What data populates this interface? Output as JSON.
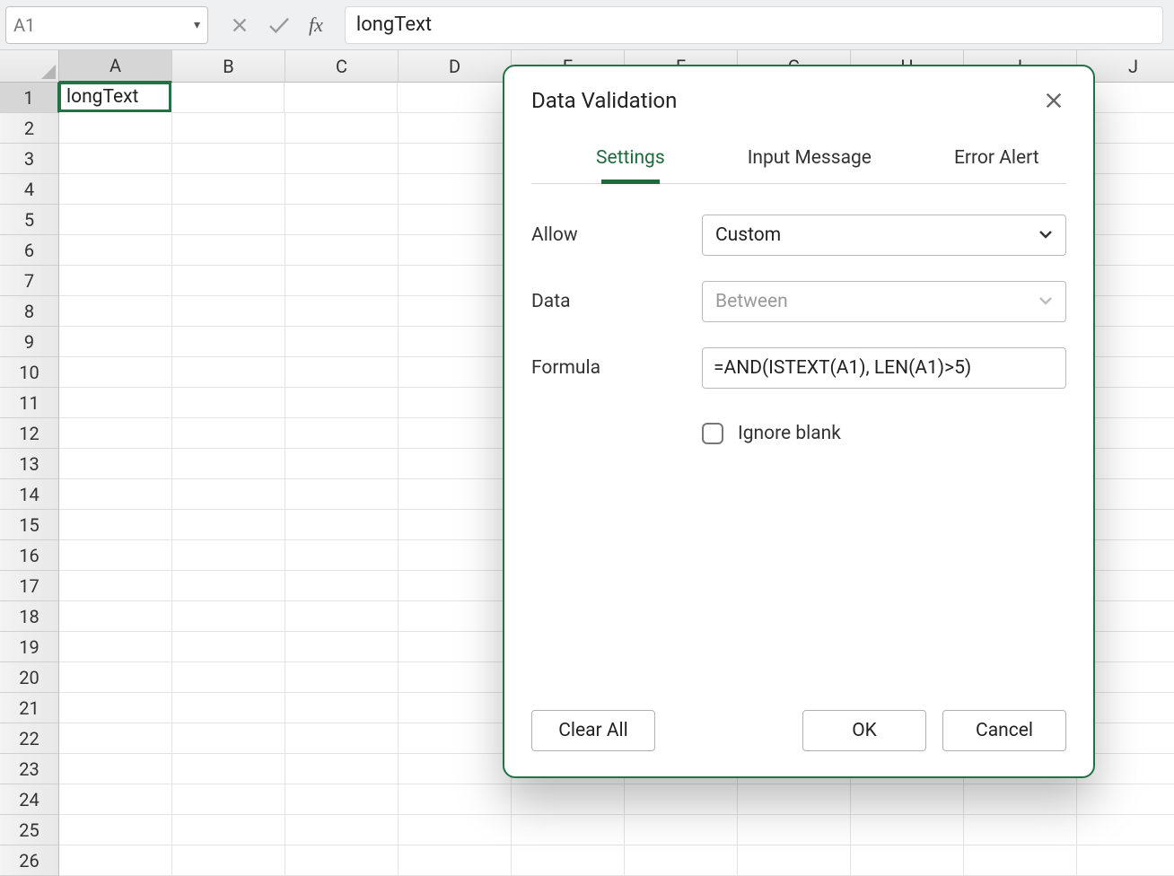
{
  "formulaBar": {
    "nameBox": "A1",
    "value": "longText",
    "fxLabel": "fx"
  },
  "sheet": {
    "columns": [
      "A",
      "B",
      "C",
      "D",
      "E",
      "F",
      "G",
      "H",
      "I",
      "J"
    ],
    "rowCount": 26,
    "activeCol": "A",
    "activeRow": 1,
    "cells": {
      "A1": "longText"
    }
  },
  "dialog": {
    "title": "Data Validation",
    "tabs": {
      "settings": "Settings",
      "inputMessage": "Input Message",
      "errorAlert": "Error Alert"
    },
    "labels": {
      "allow": "Allow",
      "data": "Data",
      "formula": "Formula",
      "ignoreBlank": "Ignore blank"
    },
    "values": {
      "allow": "Custom",
      "data": "Between",
      "formula": "=AND(ISTEXT(A1), LEN(A1)>5)"
    },
    "buttons": {
      "clearAll": "Clear All",
      "ok": "OK",
      "cancel": "Cancel"
    }
  }
}
